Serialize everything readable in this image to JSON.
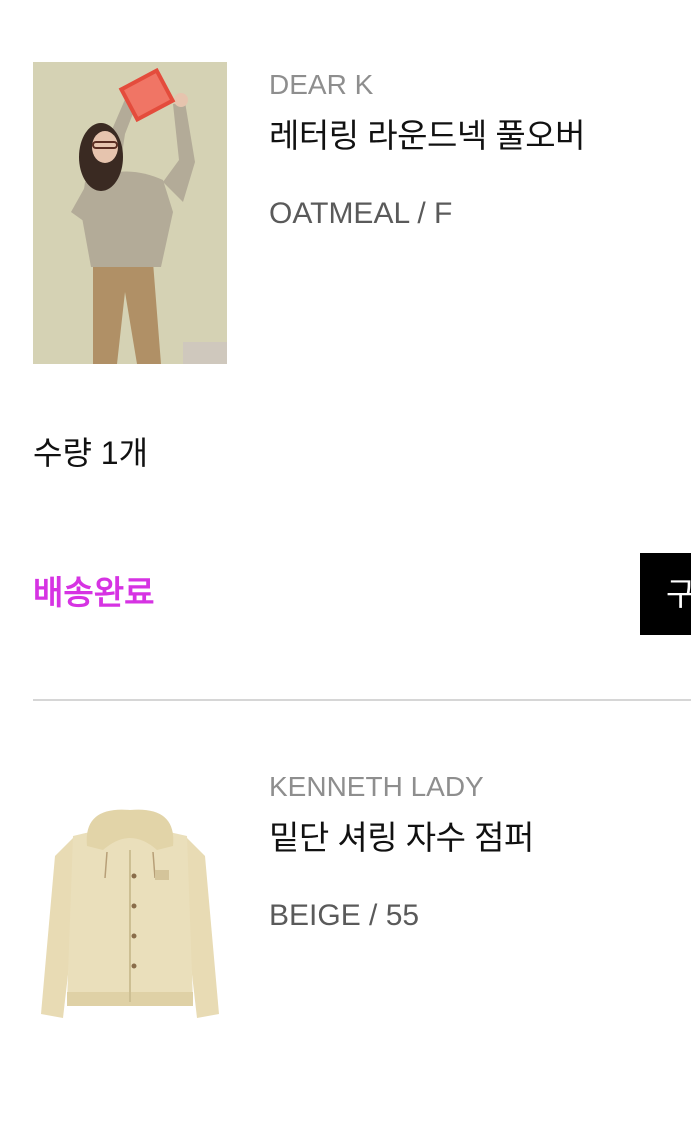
{
  "items": [
    {
      "brand": "DEAR K",
      "name": "레터링 라운드넥 풀오버",
      "option": "OATMEAL / F",
      "image_desc_icon": "product-photo-model-pullover"
    },
    {
      "brand": "KENNETH LADY",
      "name": "밑단 셔링 자수 점퍼",
      "option": "BEIGE / 55",
      "image_desc_icon": "product-photo-jacket"
    }
  ],
  "quantity_label": "수량 1개",
  "status": {
    "label": "배송완료",
    "color": "#d633e3"
  },
  "action_button": {
    "label": "구"
  },
  "colors": {
    "brand_text": "#8e8e8e",
    "option_text": "#5a5a5a",
    "divider": "#d6d6d6",
    "button_bg": "#000000"
  }
}
